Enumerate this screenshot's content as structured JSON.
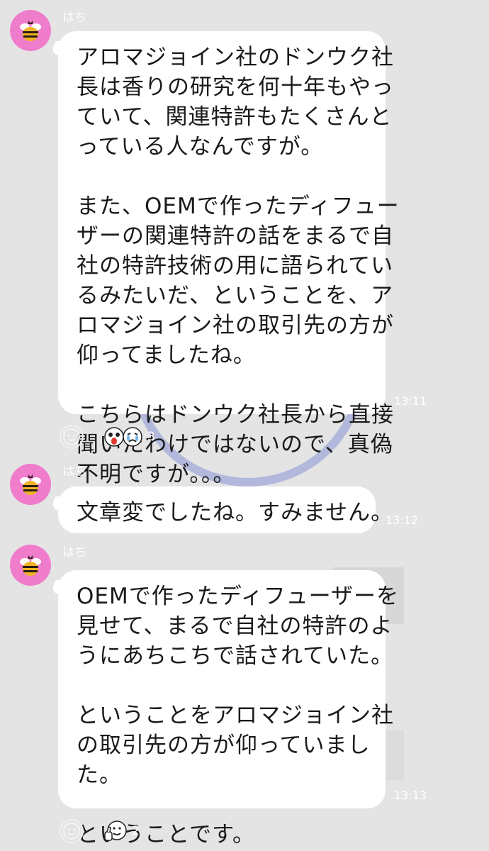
{
  "messages": [
    {
      "sender": "はち",
      "lines": [
        "アロマジョイン社のドンウク社",
        "長は香りの研究を何十年もやっ",
        "ていて、関連特許もたくさんと",
        "っている人なんですが。",
        "",
        "また、OEMで作ったディフュー",
        "ザーの関連特許の話をまるで自",
        "社の特許技術の用に語られてい",
        "るみたいだ、ということを、ア",
        "ロマジョイン社の取引先の方が",
        "仰ってましたね。",
        "",
        "こちらはドンウク社長から直接",
        "聞いたわけではないので、真偽",
        "不明ですが。。。"
      ],
      "time": "13:11",
      "reaction_count": "3",
      "reaction_icons": [
        "surprised-face-icon",
        "crying-face-icon"
      ]
    },
    {
      "sender": "はち",
      "lines": [
        "文章変でしたね。すみません。"
      ],
      "time": "13:12"
    },
    {
      "sender": "はち",
      "lines": [
        "OEMで作ったディフューザーを",
        "見せて、まるで自社の特許のよ",
        "うにあちこちで話されていた。",
        "",
        "ということをアロマジョイン社",
        "の取引先の方が仰っていまし",
        "た。",
        "",
        "ということです。"
      ],
      "time": "13:13",
      "reaction_count": "2",
      "reaction_icons": [
        "thumbs-up-face-icon"
      ]
    }
  ],
  "colors": {
    "background": "#e4e4e4",
    "bubble": "#ffffff",
    "avatar": "#f07ccc",
    "meta_text": "#ffffff"
  }
}
